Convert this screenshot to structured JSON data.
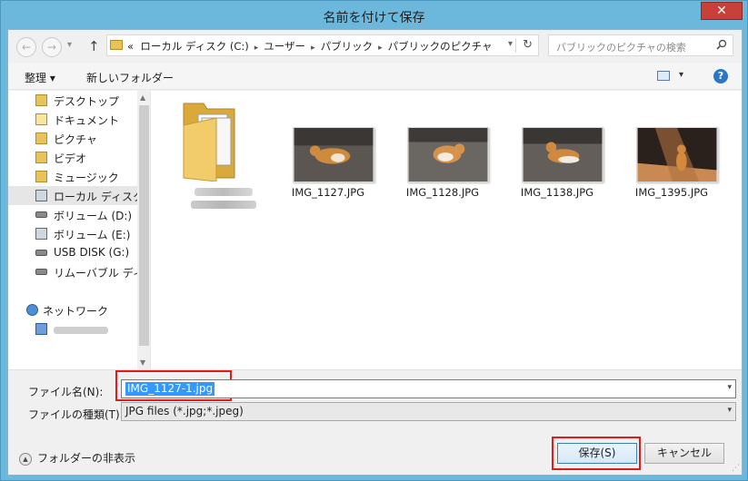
{
  "window": {
    "title": "名前を付けて保存",
    "close_glyph": "✕"
  },
  "nav": {
    "back_glyph": "←",
    "forward_glyph": "→",
    "recent_glyph": "▾",
    "up_glyph": "↑"
  },
  "address": {
    "overflow": "«",
    "crumbs": [
      "ローカル ディスク (C:)",
      "ユーザー",
      "パブリック",
      "パブリックのピクチャ"
    ],
    "separator": "▸",
    "dropdown_glyph": "▾",
    "refresh_glyph": "↻"
  },
  "search": {
    "placeholder": "パブリックのピクチャの検索",
    "icon": "search-icon"
  },
  "toolbar": {
    "organize_label": "整理 ▾",
    "new_folder_label": "新しいフォルダー",
    "view_dropdown_glyph": "▾",
    "help_glyph": "?"
  },
  "sidebar": {
    "items": [
      {
        "label": "デスクトップ",
        "icon": "folder-icon"
      },
      {
        "label": "ドキュメント",
        "icon": "documents-icon"
      },
      {
        "label": "ピクチャ",
        "icon": "pictures-icon"
      },
      {
        "label": "ビデオ",
        "icon": "videos-icon"
      },
      {
        "label": "ミュージック",
        "icon": "music-icon"
      },
      {
        "label": "ローカル ディスク (C",
        "icon": "hdd-icon",
        "selected": true
      },
      {
        "label": "ボリューム (D:)",
        "icon": "drive-icon"
      },
      {
        "label": "ボリューム (E:)",
        "icon": "hdd-icon"
      },
      {
        "label": "USB DISK (G:)",
        "icon": "usb-drive-icon"
      },
      {
        "label": "リムーバブル ディスク",
        "icon": "removable-drive-icon"
      }
    ],
    "network": {
      "label": "ネットワーク",
      "icon": "network-icon"
    },
    "scroll_up": "▲",
    "scroll_down": "▼"
  },
  "files": [
    {
      "name": "IMG_1127.JPG",
      "type": "image"
    },
    {
      "name": "IMG_1128.JPG",
      "type": "image"
    },
    {
      "name": "IMG_1138.JPG",
      "type": "image"
    },
    {
      "name": "IMG_1395.JPG",
      "type": "image"
    }
  ],
  "form": {
    "filename_label": "ファイル名(N):",
    "filename_value": "IMG_1127-1.jpg",
    "filetype_label": "ファイルの種類(T):",
    "filetype_value": "JPG files (*.jpg;*.jpeg)",
    "dropdown_glyph": "▾"
  },
  "footer": {
    "hide_folders_label": "フォルダーの非表示",
    "hide_icon_glyph": "▲",
    "save_label": "保存(S)",
    "cancel_label": "キャンセル",
    "grip_glyph": "⋰"
  },
  "colors": {
    "accent": "#3399ff",
    "highlight_box": "#e31a1a",
    "titlebar": "#6cb8dc"
  }
}
